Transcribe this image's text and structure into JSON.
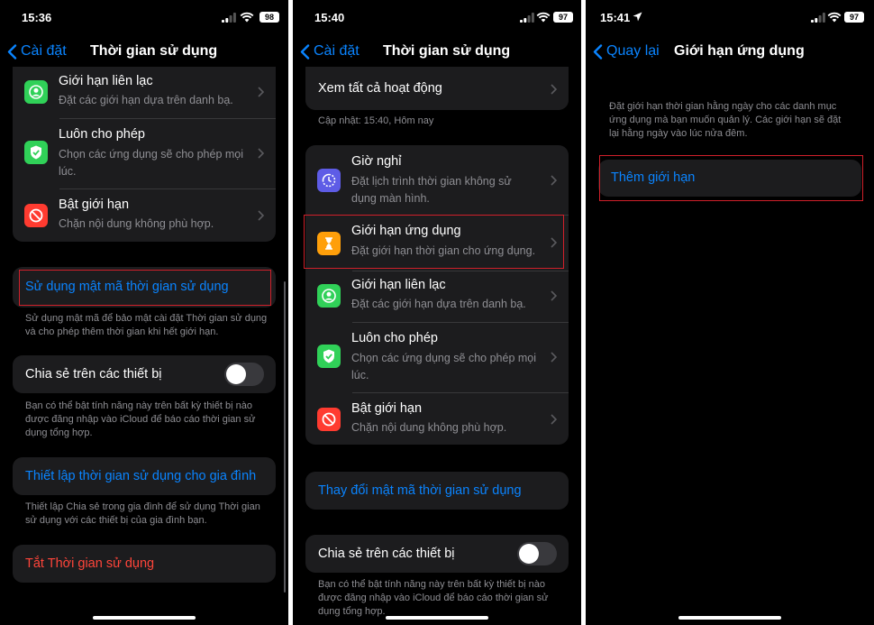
{
  "panel1": {
    "time": "15:36",
    "battery": "98",
    "back_label": "Cài đặt",
    "title": "Thời gian sử dụng",
    "rows": [
      {
        "title": "Giới hạn liên lạc",
        "subtitle": "Đặt các giới hạn dựa trên danh bạ.",
        "icon": "person-circle-icon",
        "color": "#30d158"
      },
      {
        "title": "Luôn cho phép",
        "subtitle": "Chọn các ứng dụng sẽ cho phép mọi lúc.",
        "icon": "checkmark-shield-icon",
        "color": "#30d158"
      },
      {
        "title": "Bật giới hạn",
        "subtitle": "Chặn nội dung không phù hợp.",
        "icon": "no-entry-icon",
        "color": "#ff3b30"
      }
    ],
    "passcode_link": "Sử dụng mật mã thời gian sử dụng",
    "passcode_footer": "Sử dụng mật mã để bảo mật cài đặt Thời gian sử dụng và cho phép thêm thời gian khi hết giới hạn.",
    "share_label": "Chia sẻ trên các thiết bị",
    "share_footer": "Bạn có thể bật tính năng này trên bất kỳ thiết bị nào được đăng nhập vào iCloud để báo cáo thời gian sử dụng tổng hợp.",
    "family_link": "Thiết lập thời gian sử dụng cho gia đình",
    "family_footer": "Thiết lập Chia sẻ trong gia đình để sử dụng Thời gian sử dụng với các thiết bị của gia đình bạn.",
    "turn_off": "Tắt Thời gian sử dụng"
  },
  "panel2": {
    "time": "15:40",
    "battery": "97",
    "back_label": "Cài đặt",
    "title": "Thời gian sử dụng",
    "see_all": "Xem tất cả hoạt động",
    "updated": "Cập nhật: 15:40, Hôm nay",
    "rows": [
      {
        "title": "Giờ nghỉ",
        "subtitle": "Đặt lịch trình thời gian không sử dụng màn hình.",
        "icon": "downtime-icon",
        "color": "#5e5ce6"
      },
      {
        "title": "Giới hạn ứng dụng",
        "subtitle": "Đặt giới hạn thời gian cho ứng dụng.",
        "icon": "hourglass-icon",
        "color": "#ff9f0a"
      },
      {
        "title": "Giới hạn liên lạc",
        "subtitle": "Đặt các giới hạn dựa trên danh bạ.",
        "icon": "person-circle-icon",
        "color": "#30d158"
      },
      {
        "title": "Luôn cho phép",
        "subtitle": "Chọn các ứng dụng sẽ cho phép mọi lúc.",
        "icon": "checkmark-shield-icon",
        "color": "#30d158"
      },
      {
        "title": "Bật giới hạn",
        "subtitle": "Chặn nội dung không phù hợp.",
        "icon": "no-entry-icon",
        "color": "#ff3b30"
      }
    ],
    "change_passcode": "Thay đổi mật mã thời gian sử dụng",
    "share_label": "Chia sẻ trên các thiết bị",
    "share_footer": "Bạn có thể bật tính năng này trên bất kỳ thiết bị nào được đăng nhập vào iCloud để báo cáo thời gian sử dụng tổng hợp."
  },
  "panel3": {
    "time": "15:41",
    "battery": "97",
    "back_label": "Quay lại",
    "title": "Giới hạn ứng dụng",
    "description": "Đặt giới hạn thời gian hằng ngày cho các danh mục ứng dụng mà bạn muốn quản lý. Các giới hạn sẽ đặt lại hằng ngày vào lúc nửa đêm.",
    "add_limit": "Thêm giới hạn"
  },
  "colors": {
    "accent": "#0a84ff",
    "destructive": "#ff453a",
    "highlight": "#d0202a"
  }
}
